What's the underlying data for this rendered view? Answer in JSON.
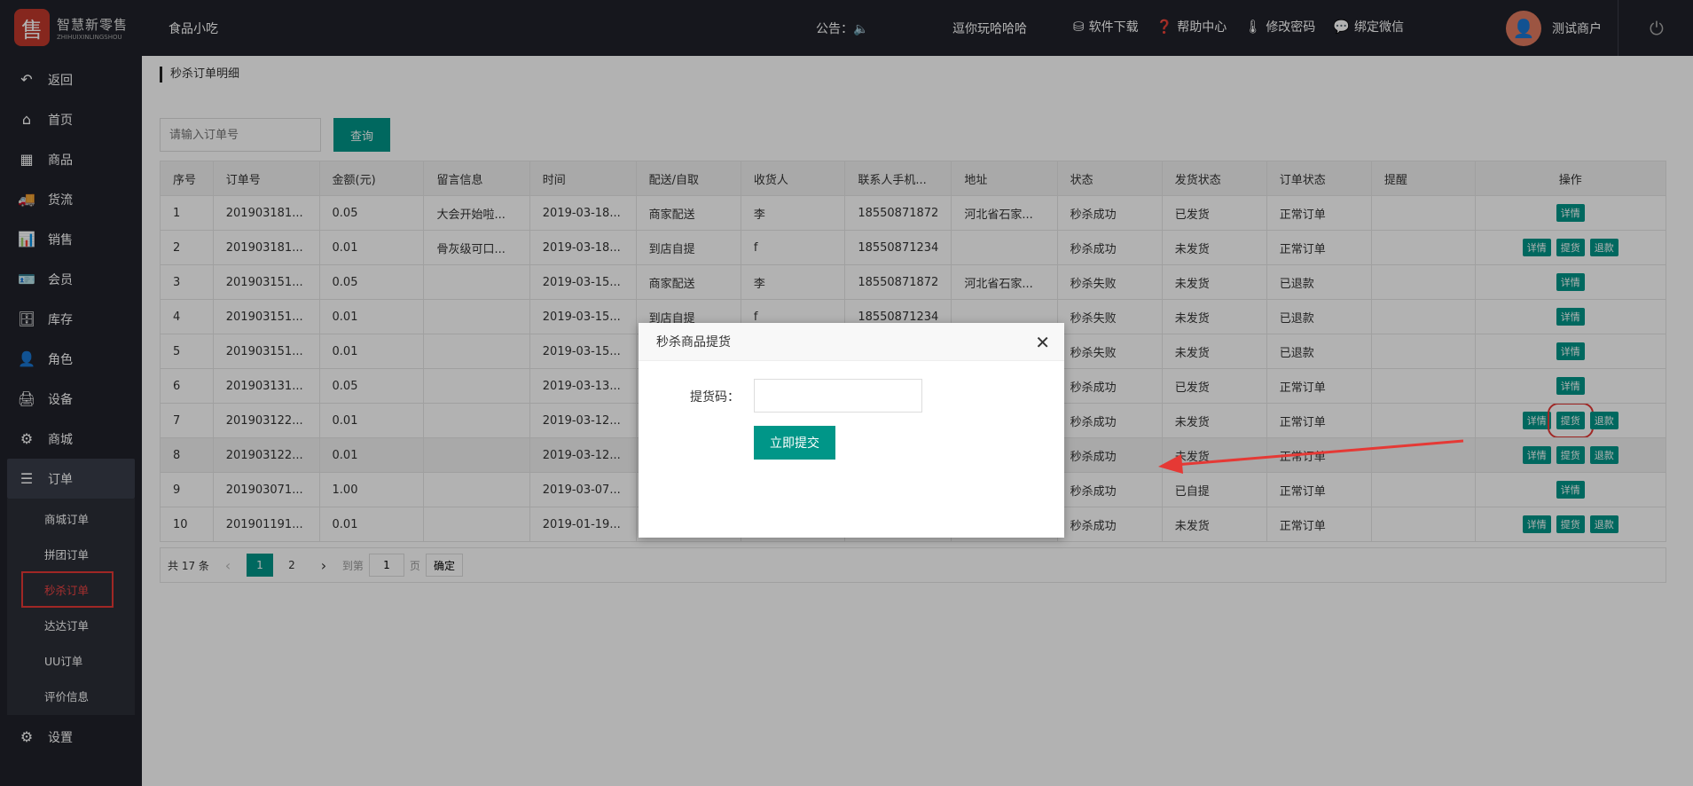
{
  "brand": {
    "title": "智慧新零售",
    "sub": "ZHIHUIXINLINGSHOU",
    "mark": "售"
  },
  "header": {
    "shop_name": "食品小吃",
    "notice_label": "公告：",
    "marquee": "逗你玩哈哈哈",
    "links": [
      {
        "icon": "download-icon",
        "glyph": "⛁",
        "label": "软件下载"
      },
      {
        "icon": "help-icon",
        "glyph": "❓",
        "label": "帮助中心"
      },
      {
        "icon": "thermometer-icon",
        "glyph": "🌡",
        "label": "修改密码"
      },
      {
        "icon": "wechat-icon",
        "glyph": "💬",
        "label": "绑定微信"
      }
    ],
    "user_name": "测试商户"
  },
  "sidebar": {
    "items": [
      {
        "name": "back",
        "label": "返回",
        "glyph": "↶"
      },
      {
        "name": "home",
        "label": "首页",
        "glyph": "⌂"
      },
      {
        "name": "goods",
        "label": "商品",
        "glyph": "▦"
      },
      {
        "name": "logistics",
        "label": "货流",
        "glyph": "🚚"
      },
      {
        "name": "sales",
        "label": "销售",
        "glyph": "📊"
      },
      {
        "name": "members",
        "label": "会员",
        "glyph": "🪪"
      },
      {
        "name": "inventory",
        "label": "库存",
        "glyph": "🗄"
      },
      {
        "name": "roles",
        "label": "角色",
        "glyph": "👤"
      },
      {
        "name": "devices",
        "label": "设备",
        "glyph": "🖨"
      },
      {
        "name": "mall",
        "label": "商城",
        "glyph": "⚙"
      },
      {
        "name": "orders",
        "label": "订单",
        "glyph": "☰"
      }
    ],
    "sub_items": [
      "商城订单",
      "拼团订单",
      "秒杀订单",
      "达达订单",
      "UU订单",
      "评价信息"
    ],
    "settings": {
      "label": "设置",
      "glyph": "⚙"
    }
  },
  "main": {
    "breadcrumb": "秒杀订单明细",
    "search_placeholder": "请输入订单号",
    "search_button": "查询",
    "columns": [
      "序号",
      "订单号",
      "金额(元)",
      "留言信息",
      "时间",
      "配送/自取",
      "收货人",
      "联系人手机...",
      "地址",
      "状态",
      "发货状态",
      "订单状态",
      "提醒",
      "操作"
    ],
    "rows": [
      [
        "1",
        "201903181...",
        "0.05",
        "大会开始啦...",
        "2019-03-18...",
        "商家配送",
        "李",
        "18550871872",
        "河北省石家...",
        "秒杀成功",
        "已发货",
        "正常订单",
        ""
      ],
      [
        "2",
        "201903181...",
        "0.01",
        "骨灰级可口...",
        "2019-03-18...",
        "到店自提",
        "f",
        "18550871234",
        "",
        "秒杀成功",
        "未发货",
        "正常订单",
        ""
      ],
      [
        "3",
        "201903151...",
        "0.05",
        "",
        "2019-03-15...",
        "商家配送",
        "李",
        "18550871872",
        "河北省石家...",
        "秒杀失败",
        "未发货",
        "已退款",
        ""
      ],
      [
        "4",
        "201903151...",
        "0.01",
        "",
        "2019-03-15...",
        "到店自提",
        "f",
        "18550871234",
        "",
        "秒杀失败",
        "未发货",
        "已退款",
        ""
      ],
      [
        "5",
        "201903151...",
        "0.01",
        "",
        "2019-03-15...",
        "",
        "",
        "",
        "",
        "秒杀失败",
        "未发货",
        "已退款",
        ""
      ],
      [
        "6",
        "201903131...",
        "0.05",
        "",
        "2019-03-13...",
        "",
        "",
        "",
        "",
        "秒杀成功",
        "已发货",
        "正常订单",
        ""
      ],
      [
        "7",
        "201903122...",
        "0.01",
        "",
        "2019-03-12...",
        "",
        "",
        "",
        "",
        "秒杀成功",
        "未发货",
        "正常订单",
        ""
      ],
      [
        "8",
        "201903122...",
        "0.01",
        "",
        "2019-03-12...",
        "",
        "",
        "",
        "",
        "秒杀成功",
        "未发货",
        "正常订单",
        ""
      ],
      [
        "9",
        "201903071...",
        "1.00",
        "",
        "2019-03-07...",
        "",
        "",
        "",
        "",
        "秒杀成功",
        "已自提",
        "正常订单",
        ""
      ],
      [
        "10",
        "201901191...",
        "0.01",
        "",
        "2019-01-19...",
        "",
        "",
        "",
        "",
        "秒杀成功",
        "未发货",
        "正常订单",
        ""
      ]
    ],
    "row_actions": [
      [
        "详情"
      ],
      [
        "详情",
        "提货",
        "退款"
      ],
      [
        "详情"
      ],
      [
        "详情"
      ],
      [
        "详情"
      ],
      [
        "详情"
      ],
      [
        "详情",
        "提货",
        "退款"
      ],
      [
        "详情",
        "提货",
        "退款"
      ],
      [
        "详情"
      ],
      [
        "详情",
        "提货",
        "退款"
      ]
    ],
    "pager": {
      "total": "共 17 条",
      "pages": [
        "1",
        "2"
      ],
      "goto_label": "到第",
      "goto_value": "1",
      "page_unit": "页",
      "confirm": "确定"
    }
  },
  "modal": {
    "title": "秒杀商品提货",
    "close_glyph": "✕",
    "code_label": "提货码：",
    "submit": "立即提交"
  },
  "colors": {
    "accent": "#009688",
    "header_bg": "#20222a",
    "highlight": "#e53935"
  }
}
